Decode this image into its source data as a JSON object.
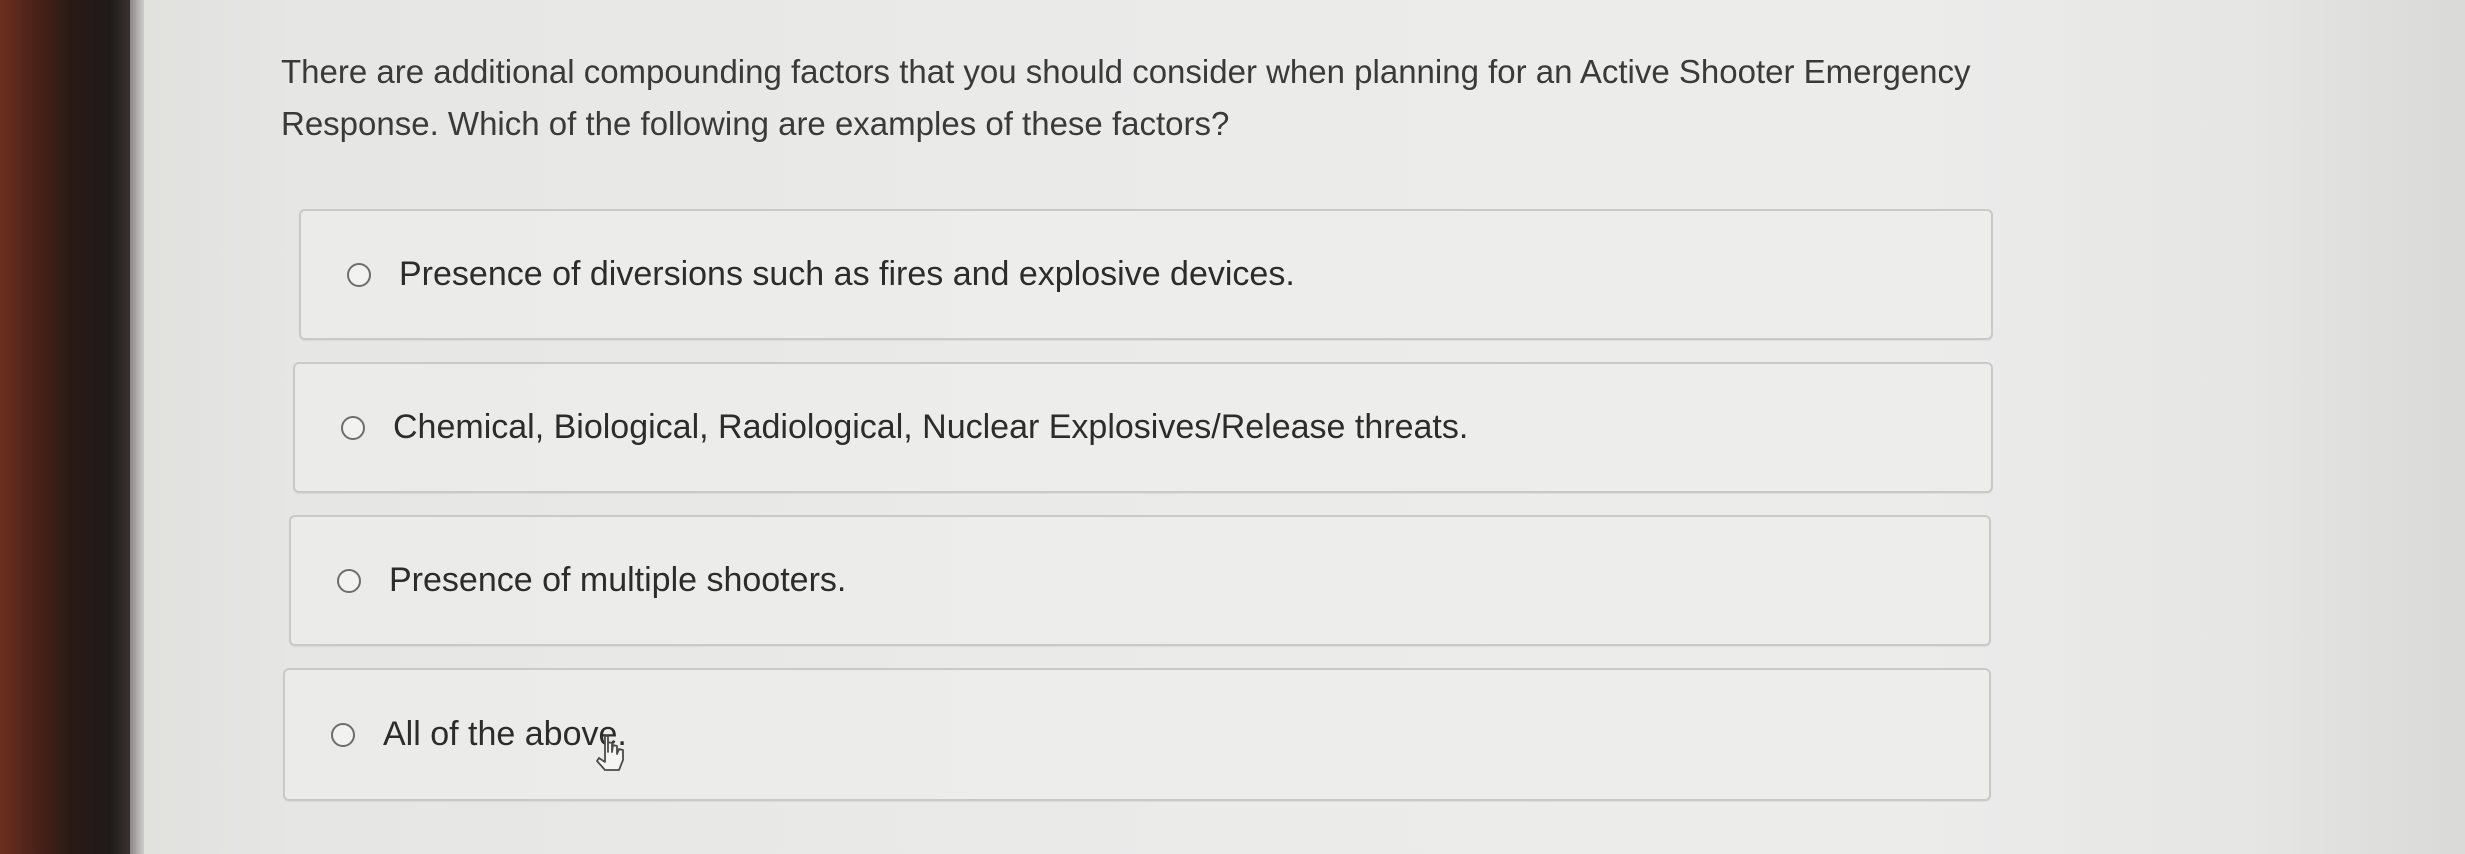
{
  "question": {
    "text": "There are additional compounding factors that you should consider when planning for an Active Shooter Emergency Response. Which of the following are examples of these factors?"
  },
  "options": [
    {
      "label": "Presence of diversions such as fires and explosive devices.",
      "selected": false
    },
    {
      "label": "Chemical, Biological, Radiological, Nuclear Explosives/Release threats.",
      "selected": false
    },
    {
      "label": "Presence of multiple shooters.",
      "selected": false
    },
    {
      "label": "All of the above.",
      "selected": false
    }
  ],
  "icons": {
    "radio": "radio-button-icon",
    "cursor": "mouse-pointer-icon"
  },
  "colors": {
    "text": "#2c2c2c",
    "border": "#c9c9c7",
    "background": "#e8e8e6"
  }
}
